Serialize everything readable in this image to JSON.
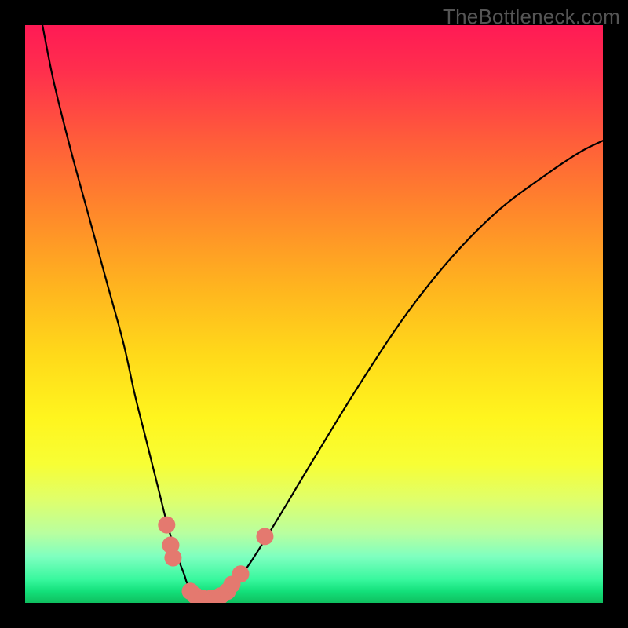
{
  "watermark": "TheBottleneck.com",
  "chart_data": {
    "type": "line",
    "title": "",
    "xlabel": "",
    "ylabel": "",
    "xlim": [
      0,
      100
    ],
    "ylim": [
      0,
      100
    ],
    "grid": false,
    "legend": false,
    "series": [
      {
        "name": "bottleneck-curve",
        "x": [
          3,
          5,
          8,
          11,
          14,
          17,
          19,
          21,
          23,
          24.5,
          26,
          27.5,
          28,
          29,
          30,
          31,
          32,
          33,
          34,
          36,
          39,
          44,
          50,
          58,
          66,
          74,
          82,
          90,
          96,
          100
        ],
        "y": [
          100,
          90,
          78,
          67,
          56,
          45,
          36,
          28,
          20,
          14,
          9,
          5,
          3.5,
          1.5,
          0.5,
          0.3,
          0.4,
          0.7,
          1.2,
          3,
          7,
          15,
          25,
          38,
          50,
          60,
          68,
          74,
          78,
          80
        ]
      }
    ],
    "markers": [
      {
        "x": 24.5,
        "y": 13.5
      },
      {
        "x": 25.2,
        "y": 10.0
      },
      {
        "x": 25.6,
        "y": 7.8
      },
      {
        "x": 28.6,
        "y": 2.0
      },
      {
        "x": 29.5,
        "y": 1.2
      },
      {
        "x": 30.8,
        "y": 0.8
      },
      {
        "x": 32.2,
        "y": 0.8
      },
      {
        "x": 33.8,
        "y": 1.2
      },
      {
        "x": 35.0,
        "y": 2.0
      },
      {
        "x": 35.8,
        "y": 3.2
      },
      {
        "x": 37.3,
        "y": 5.0
      },
      {
        "x": 41.5,
        "y": 11.5
      }
    ],
    "gradient_stops": [
      {
        "pos": 0.0,
        "color": "#ff1a55"
      },
      {
        "pos": 0.33,
        "color": "#ff8a2a"
      },
      {
        "pos": 0.68,
        "color": "#fff51e"
      },
      {
        "pos": 0.96,
        "color": "#37f79d"
      },
      {
        "pos": 1.0,
        "color": "#0fbf5f"
      }
    ]
  }
}
